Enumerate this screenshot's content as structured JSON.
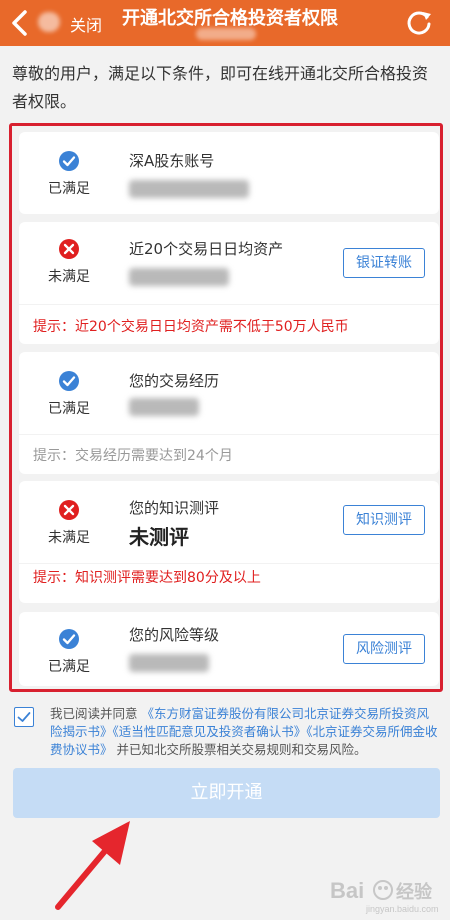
{
  "header": {
    "close_label": "关闭",
    "title": "开通北交所合格投资者权限",
    "back_icon": "back-icon",
    "refresh_icon": "refresh-icon"
  },
  "intro": "尊敬的用户，满足以下条件，即可在线开通北交所合格投资者权限。",
  "items": [
    {
      "status": "已满足",
      "state": "ok",
      "title": "深A股东账号",
      "value": ""
    },
    {
      "status": "未满足",
      "state": "fail",
      "title": "近20个交易日日均资产",
      "value": "",
      "button": "银证转账",
      "hint": "提示：近20个交易日日均资产需不低于50万人民币"
    },
    {
      "status": "已满足",
      "state": "ok",
      "title": "您的交易经历",
      "value": "",
      "hint": "提示：交易经历需要达到24个月"
    },
    {
      "status": "未满足",
      "state": "fail",
      "title": "您的知识测评",
      "value": "未测评",
      "button": "知识测评",
      "hint": "提示：知识测评需要达到80分及以上"
    },
    {
      "status": "已满足",
      "state": "ok",
      "title": "您的风险等级",
      "value": "",
      "button": "风险测评"
    }
  ],
  "agreement": {
    "prefix": "我已阅读并同意",
    "link1": "《东方财富证券股份有限公司北京证券交易所投资风险揭示书》",
    "link2": "《适当性匹配意见及投资者确认书》",
    "link3": "《北京证券交易所佣金收费协议书》",
    "suffix": "并已知北交所股票相关交易规则和交易风险。"
  },
  "submit_label": "立即开通",
  "watermark": "Bai经验",
  "colors": {
    "header": "#e8692a",
    "ok": "#3b82d6",
    "fail": "#e02020",
    "highlight_border": "#d8202f",
    "submit_disabled": "#c5dcf5"
  }
}
